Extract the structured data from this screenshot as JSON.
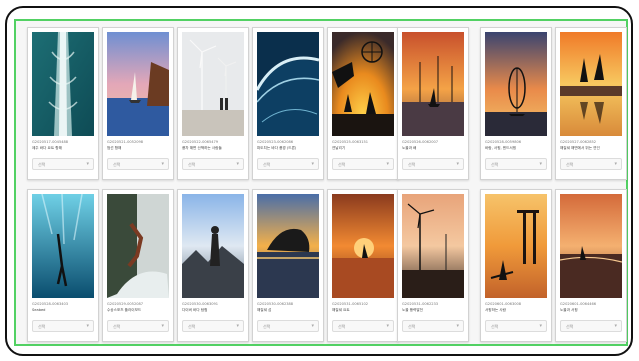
{
  "gallery": {
    "cards": [
      {
        "code": "G2020517-0045488",
        "title": "제주 바다 요트 항해",
        "select": "선택",
        "image": "boat-wake-photo"
      },
      {
        "code": "G2020521-0052098",
        "title": "범선 항해",
        "select": "선택",
        "image": "sailboat-cliff-photo"
      },
      {
        "code": "G2020522-0065479",
        "title": "풍차 해변 산책하는 사람들",
        "select": "선택",
        "image": "wind-turbine-couple-photo"
      },
      {
        "code": "G2020523-0062086",
        "title": "파도치는 바다 풍경 (드론)",
        "select": "선택",
        "image": "ocean-wave-aerial-photo"
      },
      {
        "code": "G2020525-0063151",
        "title": "연날리기",
        "select": "선택",
        "image": "kite-silhouette-photo"
      },
      {
        "code": "G2020526-0062007",
        "title": "노을과 배",
        "select": "선택",
        "image": "sunset-turbines-boat-photo"
      },
      {
        "code": "G2020528-0059806",
        "title": "바람, 서핑, 윈드서핑",
        "select": "선택",
        "image": "windsurfer-sunset-photo"
      },
      {
        "code": "G2020527-0062852",
        "title": "해질녘 해변에서 뛰는 연인",
        "select": "선택",
        "image": "couple-jumping-beach-photo"
      },
      {
        "code": "G2020528-0063403",
        "title": "Seabed",
        "select": "선택",
        "image": "freediver-underwater-photo"
      },
      {
        "code": "G2020529-0052087",
        "title": "수상스포츠 플라이보드",
        "select": "선택",
        "image": "flyboard-photo"
      },
      {
        "code": "G2020530-0063091",
        "title": "다이버 바다 탐험",
        "select": "선택",
        "image": "diver-rocks-photo"
      },
      {
        "code": "G2020530-0062388",
        "title": "해질녘 섬",
        "select": "선택",
        "image": "island-sunset-photo"
      },
      {
        "code": "G2020531-0065102",
        "title": "해질녘 요트",
        "select": "선택",
        "image": "yacht-sunset-photo"
      },
      {
        "code": "G2020531-0062233",
        "title": "노을 풍력발전",
        "select": "선택",
        "image": "turbine-sunset-photo"
      },
      {
        "code": "G2020601-0063008",
        "title": "서핑하는 사람",
        "select": "선택",
        "image": "surfer-pier-photo"
      },
      {
        "code": "G2020601-0064466",
        "title": "노을과 서핑",
        "select": "선택",
        "image": "surf-sunset-photo"
      }
    ]
  }
}
